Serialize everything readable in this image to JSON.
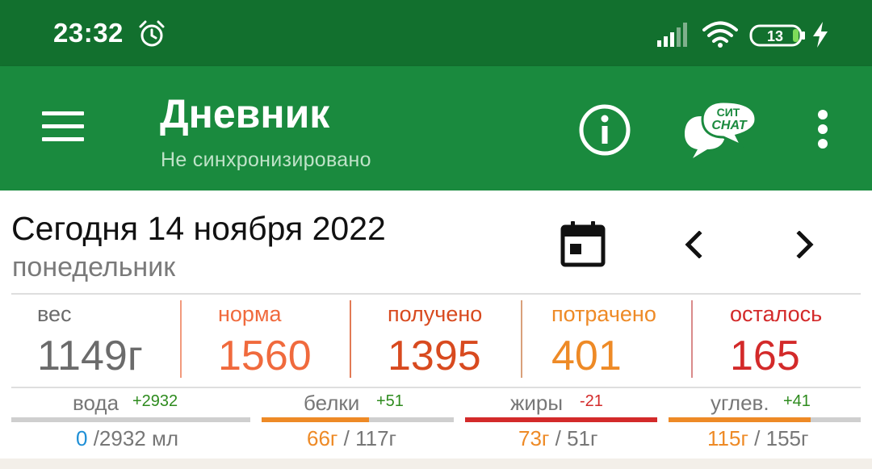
{
  "status_bar": {
    "time": "23:32",
    "battery_level": "13",
    "icons": [
      "alarm-icon",
      "signal-icon",
      "wifi-icon",
      "battery-icon",
      "charging-icon"
    ]
  },
  "app_bar": {
    "title": "Дневник",
    "subtitle": "Не синхронизировано",
    "chat_logo_top": "СИТ",
    "chat_logo_bottom": "CHAT",
    "icons": [
      "menu-icon",
      "info-icon",
      "chat-icon",
      "more-vert-icon"
    ]
  },
  "date_header": {
    "date": "Сегодня 14 ноября 2022",
    "weekday": "понедельник",
    "icons": [
      "calendar-icon",
      "chevron-left-icon",
      "chevron-right-icon"
    ]
  },
  "stats": [
    {
      "label": "вес",
      "value": "1149г",
      "label_color": "#6b6b6b",
      "value_color": "#6b6b6b"
    },
    {
      "label": "норма",
      "value": "1560",
      "label_color": "#f06a3d",
      "value_color": "#f06a3d"
    },
    {
      "label": "получено",
      "value": "1395",
      "label_color": "#d84a1f",
      "value_color": "#d84a1f"
    },
    {
      "label": "потрачено",
      "value": "401",
      "label_color": "#ee8a26",
      "value_color": "#ee8a26"
    },
    {
      "label": "осталось",
      "value": "165",
      "label_color": "#d32a2a",
      "value_color": "#d32a2a"
    }
  ],
  "macros": [
    {
      "name": "вода",
      "delta": "+2932",
      "delta_color": "#2e8b1e",
      "current": "0",
      "current_color": "#1e8fd6",
      "total": " /2932 мл",
      "fill_fraction": 0.0,
      "fill_color": "#1e8fd6"
    },
    {
      "name": "белки",
      "delta": "+51",
      "delta_color": "#2e8b1e",
      "current": "66г",
      "current_color": "#ee8a26",
      "total": " / 117г",
      "fill_fraction": 0.56,
      "fill_color": "#ee8a26"
    },
    {
      "name": "жиры",
      "delta": "-21",
      "delta_color": "#d32a2a",
      "current": "73г",
      "current_color": "#ee8a26",
      "total": " / 51г",
      "fill_fraction": 1.0,
      "fill_color": "#d32a2a"
    },
    {
      "name": "углев.",
      "delta": "+41",
      "delta_color": "#2e8b1e",
      "current": "115г",
      "current_color": "#ee8a26",
      "total": " / 155г",
      "fill_fraction": 0.74,
      "fill_color": "#ee8a26"
    }
  ],
  "colors": {
    "status_bar": "#12702e",
    "app_bar": "#1a8a3e"
  }
}
